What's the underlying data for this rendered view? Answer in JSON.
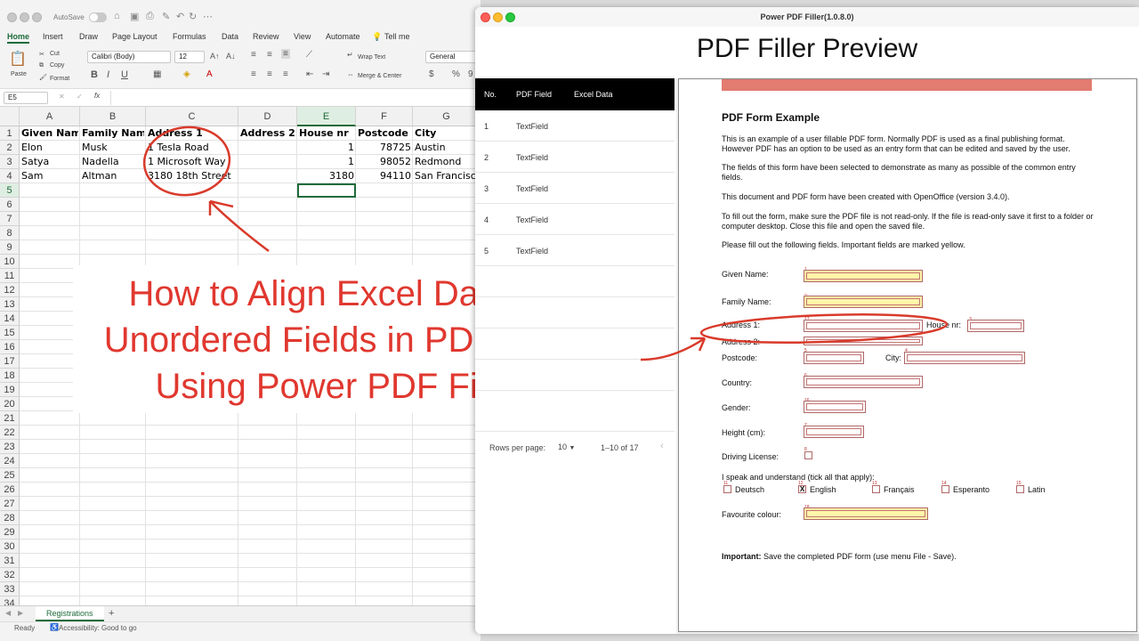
{
  "excel": {
    "autosave_label": "AutoSave",
    "ribbon_tabs": [
      "Home",
      "Insert",
      "Draw",
      "Page Layout",
      "Formulas",
      "Data",
      "Review",
      "View",
      "Automate",
      "Tell me"
    ],
    "font_name": "Calibri (Body)",
    "font_size": "12",
    "number_format": "General",
    "paste_label": "Paste",
    "cut_label": "Cut",
    "copy_label": "Copy",
    "format_label": "Format",
    "wrap_text_label": "Wrap Text",
    "merge_center_label": "Merge & Center",
    "name_box": "E5",
    "fx_label": "fx",
    "columns": [
      "A",
      "B",
      "C",
      "D",
      "E",
      "F",
      "G"
    ],
    "rows": [
      "1",
      "2",
      "3",
      "4",
      "5",
      "6",
      "7",
      "8",
      "9",
      "10",
      "11",
      "12",
      "13",
      "14",
      "15",
      "16",
      "17",
      "18",
      "19",
      "20",
      "21",
      "22",
      "23",
      "24",
      "25",
      "26",
      "27",
      "28",
      "29",
      "30",
      "31",
      "32",
      "33",
      "34"
    ],
    "headers": [
      "Given Name",
      "Family Name",
      "Address 1",
      "Address 2",
      "House nr",
      "Postcode",
      "City"
    ],
    "data_rows": [
      [
        "Elon",
        "Musk",
        "1 Tesla Road",
        "",
        "1",
        "78725",
        "Austin"
      ],
      [
        "Satya",
        "Nadella",
        "1 Microsoft Way",
        "",
        "1",
        "98052",
        "Redmond"
      ],
      [
        "Sam",
        "Altman",
        "3180 18th Street",
        "",
        "3180",
        "94110",
        "San Francisco"
      ]
    ],
    "sheet_tab": "Registrations",
    "add_sheet": "+",
    "status_ready": "Ready",
    "status_accessibility": "Accessibility: Good to go"
  },
  "overlay": {
    "lines": [
      "How to Align Excel Data with",
      "Unordered Fields in PDF Forms",
      "Using Power PDF Filler ?"
    ],
    "color": "#e0382f"
  },
  "pdf_filler": {
    "window_title": "Power PDF Filler(1.0.8.0)",
    "heading": "PDF Filler Preview",
    "table_headers": [
      "No.",
      "PDF Field",
      "Excel Data"
    ],
    "table_rows": [
      {
        "no": "1",
        "field": "TextField"
      },
      {
        "no": "2",
        "field": "TextField"
      },
      {
        "no": "3",
        "field": "TextField"
      },
      {
        "no": "4",
        "field": "TextField"
      },
      {
        "no": "5",
        "field": "TextField"
      }
    ],
    "rows_per_page_label": "Rows per page:",
    "rows_per_page_value": "10",
    "page_range": "1–10 of 17"
  },
  "pdf_form": {
    "title": "PDF Form Example",
    "para1": "This is an example of a user fillable PDF form. Normally PDF is used as a final publishing format. However PDF has an option to be used as an entry form that can be edited and saved by the user.",
    "para2": "The fields of this form have been selected to demonstrate as many as possible of the common entry fields.",
    "para3": "This document and PDF form have been created with OpenOffice (version 3.4.0).",
    "para4": "To fill out the form, make sure the PDF file is not read-only. If the file is read-only save it first to a folder or computer desktop. Close this file and open the saved file.",
    "para5": "Please fill out the following fields. Important fields are marked yellow.",
    "given_name": "Given Name:",
    "family_name": "Family Name:",
    "address1": "Address 1:",
    "address2": "Address 2:",
    "house_nr": "House nr:",
    "postcode": "Postcode:",
    "city": "City:",
    "country": "Country:",
    "gender": "Gender:",
    "height": "Height (cm):",
    "driving": "Driving License:",
    "languages_label": "I speak and understand (tick all that apply):",
    "languages": [
      "Deutsch",
      "English",
      "Français",
      "Esperanto",
      "Latin"
    ],
    "favourite_colour": "Favourite colour:",
    "important_bold": "Important:",
    "important_text": "Save the completed PDF form (use menu File - Save).",
    "field_numbers": {
      "given": "1",
      "family": "2",
      "address1": "17",
      "house": "3",
      "postcode": "5",
      "city": "4",
      "country": "6",
      "gender": "16",
      "height": "7",
      "driving": "8",
      "lang1": "11",
      "lang2": "12",
      "lang3": "13",
      "lang4": "14",
      "lang5": "15",
      "colour": "18"
    },
    "checked_mark": "X"
  }
}
